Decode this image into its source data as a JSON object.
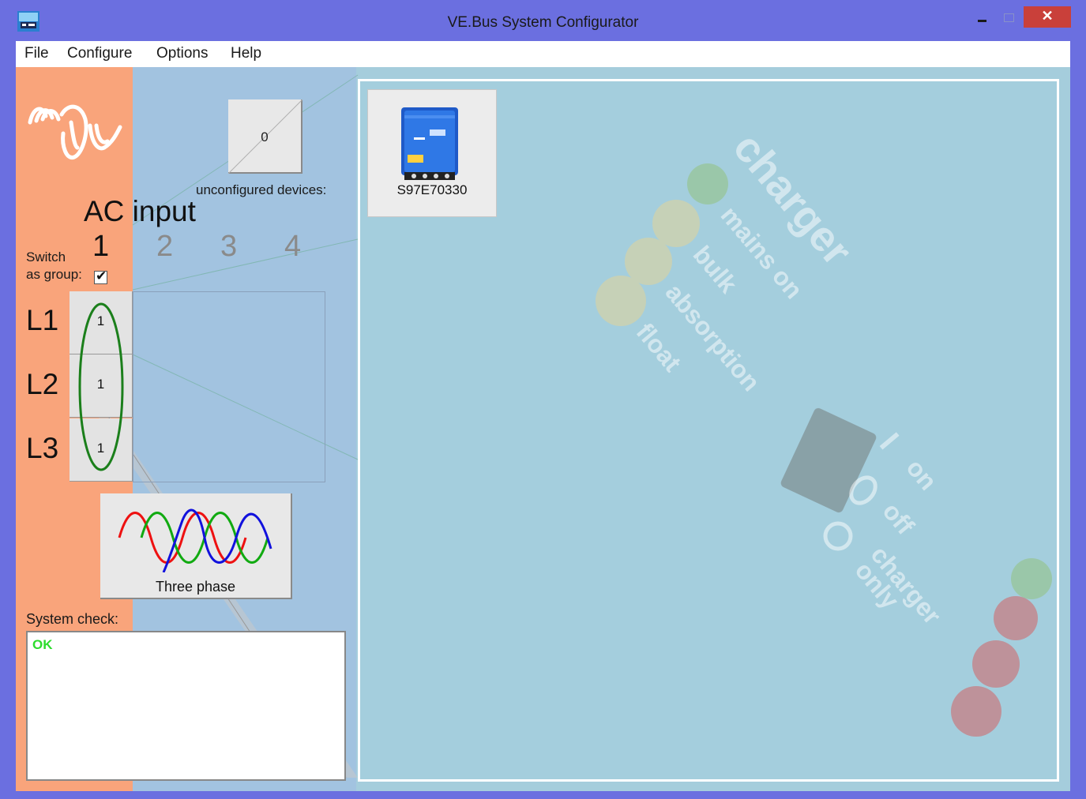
{
  "window": {
    "title": "VE.Bus System Configurator",
    "close_glyph": "✕"
  },
  "menu": {
    "items": [
      "File",
      "Configure",
      "Options",
      "Help"
    ]
  },
  "unconfigured": {
    "count": "0",
    "label": "unconfigured devices:"
  },
  "ac_input": {
    "label": "AC input",
    "inputs": [
      "1",
      "2",
      "3",
      "4"
    ]
  },
  "switch_group": {
    "label_line1": "Switch",
    "label_line2": "as group:",
    "checked": true
  },
  "phases": [
    {
      "label": "L1",
      "value": "1"
    },
    {
      "label": "L2",
      "value": "1"
    },
    {
      "label": "L3",
      "value": "1"
    }
  ],
  "three_phase_button": {
    "label": "Three phase"
  },
  "system_check": {
    "label": "System check:",
    "status": "OK",
    "status_color": "#2ddc2d"
  },
  "device": {
    "serial": "S97E70330"
  },
  "background_panel": {
    "texts": [
      "charger",
      "mains on",
      "bulk",
      "absorption",
      "float",
      "on",
      "off",
      "charger",
      "only",
      "I"
    ]
  },
  "colors": {
    "frame": "#6b6fe0",
    "close": "#c9403a",
    "orange_panel": "#f9a47b",
    "blue_panel": "#a2c3e0",
    "main_bg": "#a4cedd"
  }
}
